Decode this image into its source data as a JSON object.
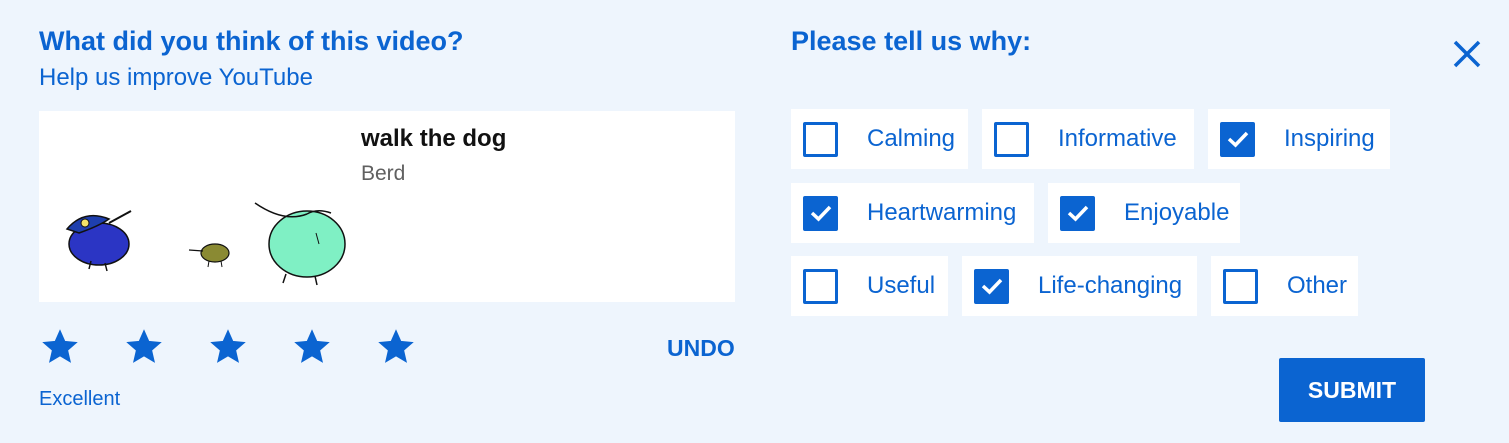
{
  "question": {
    "title": "What did you think of this video?",
    "subtitle": "Help us improve YouTube"
  },
  "video": {
    "title": "walk the dog",
    "channel": "Berd"
  },
  "rating": {
    "value": 5,
    "max": 5,
    "label": "Excellent",
    "undo_label": "UNDO",
    "star_color": "#0b64d1"
  },
  "reasons": {
    "title": "Please tell us why:",
    "options": [
      {
        "label": "Calming",
        "checked": false
      },
      {
        "label": "Informative",
        "checked": false
      },
      {
        "label": "Inspiring",
        "checked": true
      },
      {
        "label": "Heartwarming",
        "checked": true
      },
      {
        "label": "Enjoyable",
        "checked": true
      },
      {
        "label": "Useful",
        "checked": false
      },
      {
        "label": "Life-changing",
        "checked": true
      },
      {
        "label": "Other",
        "checked": false
      }
    ]
  },
  "submit_label": "SUBMIT",
  "close_icon": "close-icon",
  "colors": {
    "accent": "#0b64d1",
    "background": "#eef5fd"
  }
}
